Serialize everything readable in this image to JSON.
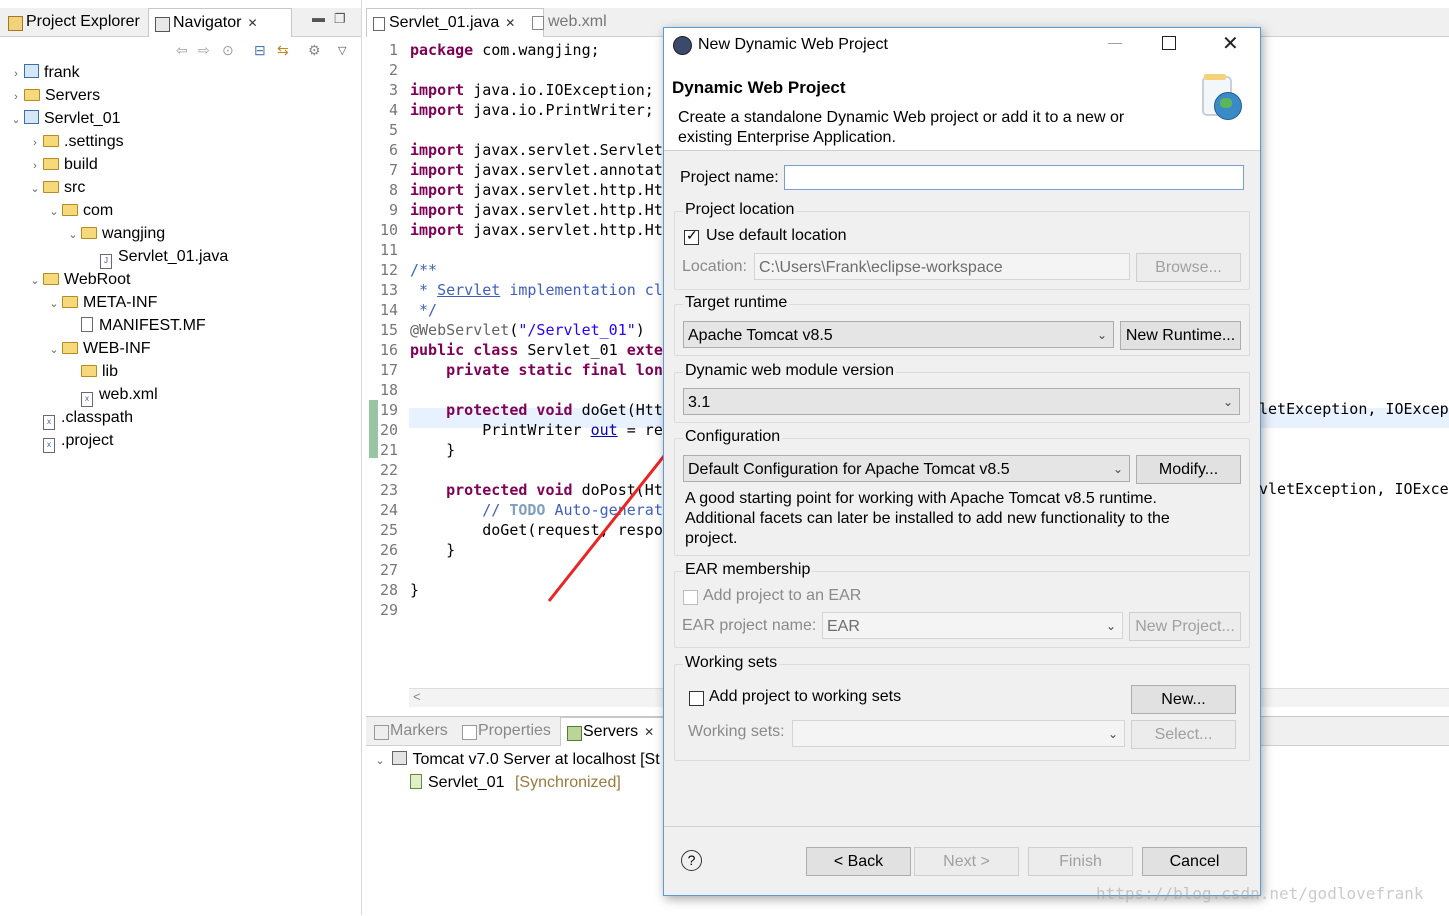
{
  "navigator": {
    "tabs": [
      {
        "label": "Project Explorer"
      },
      {
        "label": "Navigator"
      }
    ],
    "tree": [
      {
        "label": "frank",
        "icon": "project-icon",
        "depth": 0,
        "expanded": false
      },
      {
        "label": "Servers",
        "icon": "folder-icon",
        "depth": 0,
        "expanded": false
      },
      {
        "label": "Servlet_01",
        "icon": "project-icon",
        "depth": 0,
        "expanded": true
      },
      {
        "label": ".settings",
        "icon": "folder-icon",
        "depth": 1,
        "expanded": false
      },
      {
        "label": "build",
        "icon": "folder-icon",
        "depth": 1,
        "expanded": false
      },
      {
        "label": "src",
        "icon": "folder-icon",
        "depth": 1,
        "expanded": true
      },
      {
        "label": "com",
        "icon": "folder-icon",
        "depth": 2,
        "expanded": true
      },
      {
        "label": "wangjing",
        "icon": "folder-icon",
        "depth": 3,
        "expanded": true
      },
      {
        "label": "Servlet_01.java",
        "icon": "java-file-icon",
        "depth": 4,
        "leaf": true
      },
      {
        "label": "WebRoot",
        "icon": "folder-icon",
        "depth": 1,
        "expanded": true
      },
      {
        "label": "META-INF",
        "icon": "folder-icon",
        "depth": 2,
        "expanded": true
      },
      {
        "label": "MANIFEST.MF",
        "icon": "file-icon",
        "depth": 3,
        "leaf": true
      },
      {
        "label": "WEB-INF",
        "icon": "folder-icon",
        "depth": 2,
        "expanded": true
      },
      {
        "label": "lib",
        "icon": "folder-icon",
        "depth": 3,
        "leaf": true
      },
      {
        "label": "web.xml",
        "icon": "xml-file-icon",
        "depth": 3,
        "leaf": true
      },
      {
        "label": ".classpath",
        "icon": "xml-file-icon",
        "depth": 1,
        "leaf": true
      },
      {
        "label": ".project",
        "icon": "xml-file-icon",
        "depth": 1,
        "leaf": true
      }
    ]
  },
  "editor": {
    "tabs": [
      {
        "label": "Servlet_01.java"
      },
      {
        "label": "web.xml"
      }
    ],
    "line_numbers": [
      "1",
      "2",
      "3",
      "4",
      "5",
      "6",
      "7",
      "8",
      "9",
      "10",
      "11",
      "12",
      "13",
      "14",
      "15",
      "16",
      "17",
      "18",
      "19",
      "20",
      "21",
      "22",
      "23",
      "24",
      "25",
      "26",
      "27",
      "28",
      "29"
    ],
    "overflow_right": {
      "line19": "letException, IOExcept",
      "line23": "vletException, IOExcep"
    }
  },
  "servers_view": {
    "tabs": [
      {
        "label": "Markers"
      },
      {
        "label": "Properties"
      },
      {
        "label": "Servers"
      }
    ],
    "server": "Tomcat v7.0 Server at localhost  [St",
    "module": "Servlet_01",
    "module_state": "[Synchronized]"
  },
  "dialog": {
    "window_title": "New Dynamic Web Project",
    "heading": "Dynamic Web Project",
    "description": "Create a standalone Dynamic Web project or add it to a new or existing Enterprise Application.",
    "project_name_label": "Project name:",
    "project_name_value": "",
    "location_group": "Project location",
    "use_default_label": "Use default location",
    "location_label": "Location:",
    "location_value": "C:\\Users\\Frank\\eclipse-workspace",
    "browse_label": "Browse...",
    "runtime_group": "Target runtime",
    "runtime_value": "Apache Tomcat v8.5",
    "new_runtime_label": "New Runtime...",
    "module_group": "Dynamic web module version",
    "module_value": "3.1",
    "config_group": "Configuration",
    "config_value": "Default Configuration for Apache Tomcat v8.5",
    "modify_label": "Modify...",
    "config_description": "A good starting point for working with Apache Tomcat v8.5 runtime. Additional facets can later be installed to add new functionality to the project.",
    "ear_group": "EAR membership",
    "add_ear_label": "Add project to an EAR",
    "ear_name_label": "EAR project name:",
    "ear_name_value": "EAR",
    "new_project_label": "New Project...",
    "working_sets_group": "Working sets",
    "add_ws_label": "Add project to working sets",
    "new_ws_label": "New...",
    "ws_label": "Working sets:",
    "select_label": "Select...",
    "back_label": "< Back",
    "next_label": "Next >",
    "finish_label": "Finish",
    "cancel_label": "Cancel",
    "help_label": "?"
  },
  "watermark": "https://blog.csdn.net/godlovefrank",
  "colors": {
    "accent_border": "#5b9bd5",
    "annotation_arrow": "#ee2222",
    "keyword": "#7f0055",
    "javadoc": "#3f5fbf"
  }
}
